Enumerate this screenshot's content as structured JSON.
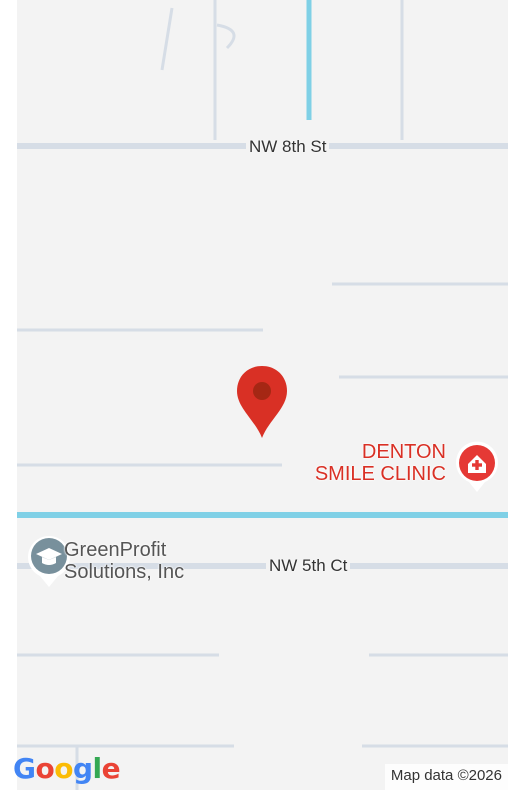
{
  "streets": {
    "nw_8th": "NW 8th St",
    "nw_5th_ct": "NW 5th Ct"
  },
  "pois": {
    "clinic_line1": "DENTON",
    "clinic_line2": "SMILE CLINIC",
    "greenprofit_line1": "GreenProfit",
    "greenprofit_line2": "Solutions, Inc"
  },
  "logo": {
    "letters": [
      "G",
      "o",
      "o",
      "g",
      "l",
      "e"
    ],
    "colors": [
      "#4285F4",
      "#EA4335",
      "#FBBC05",
      "#4285F4",
      "#34A853",
      "#EA4335"
    ]
  },
  "attribution": "Map data ©2026",
  "colors": {
    "road": "#d6dde6",
    "water": "#7fd0e6",
    "pin": "#d93025",
    "clinic_icon": "#e53935",
    "school_icon": "#78909c"
  },
  "icons": {
    "location_pin": "map-pin-icon",
    "clinic": "medical-cross-icon",
    "school": "graduation-cap-icon"
  }
}
